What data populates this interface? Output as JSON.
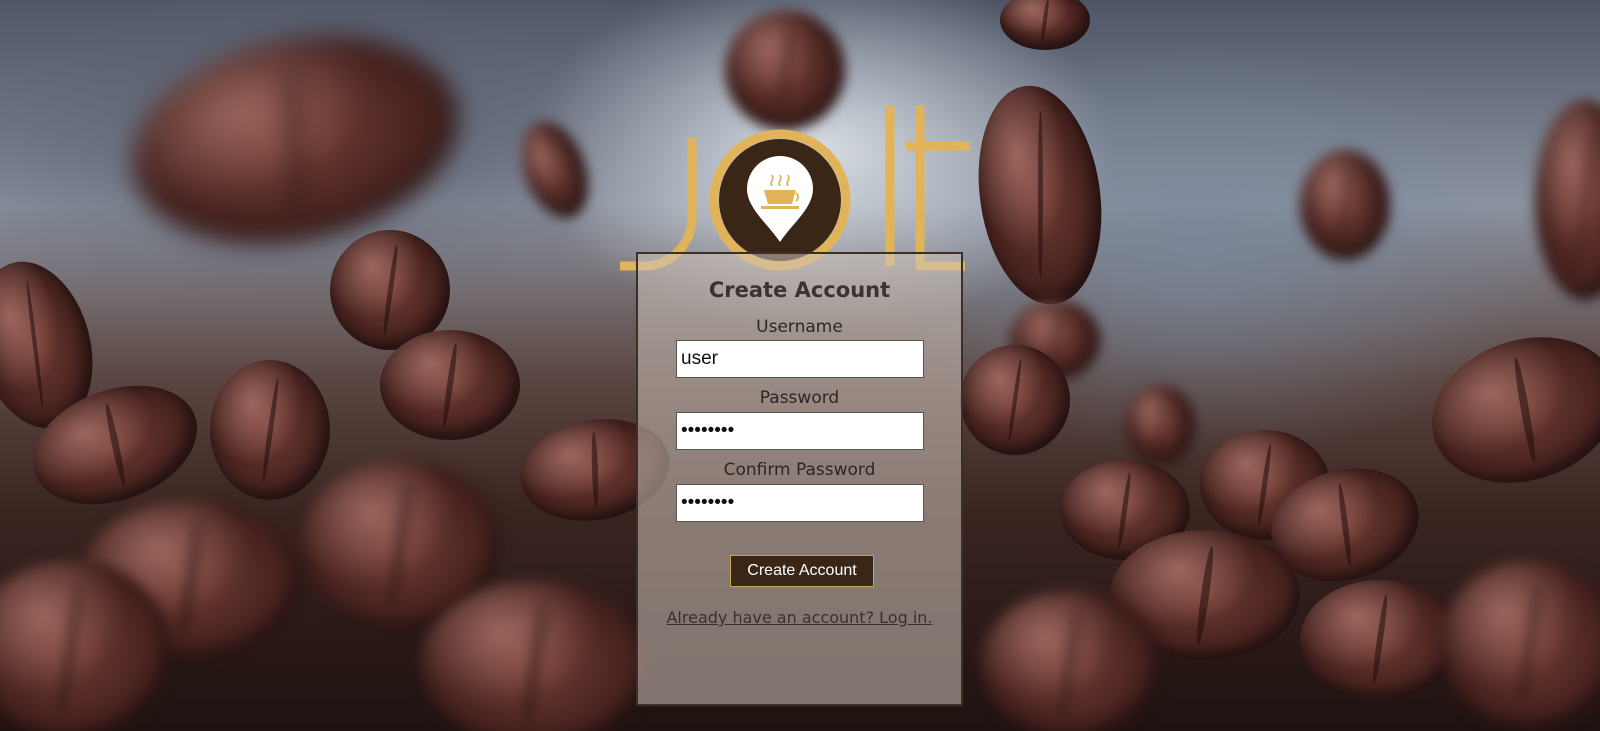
{
  "brand": {
    "logo_text": "jolt",
    "logo_color": "#e2b45a",
    "marker_color": "#3a2616"
  },
  "form": {
    "title": "Create Account",
    "username": {
      "label": "Username",
      "value": "user"
    },
    "password": {
      "label": "Password",
      "value": "password"
    },
    "confirm_password": {
      "label": "Confirm Password",
      "value": "password"
    },
    "submit_label": "Create Account",
    "login_link": "Already have an account? Log in."
  },
  "colors": {
    "button_bg": "#3a2616",
    "button_border": "#c7a35a",
    "panel_border": "#3b3028"
  }
}
